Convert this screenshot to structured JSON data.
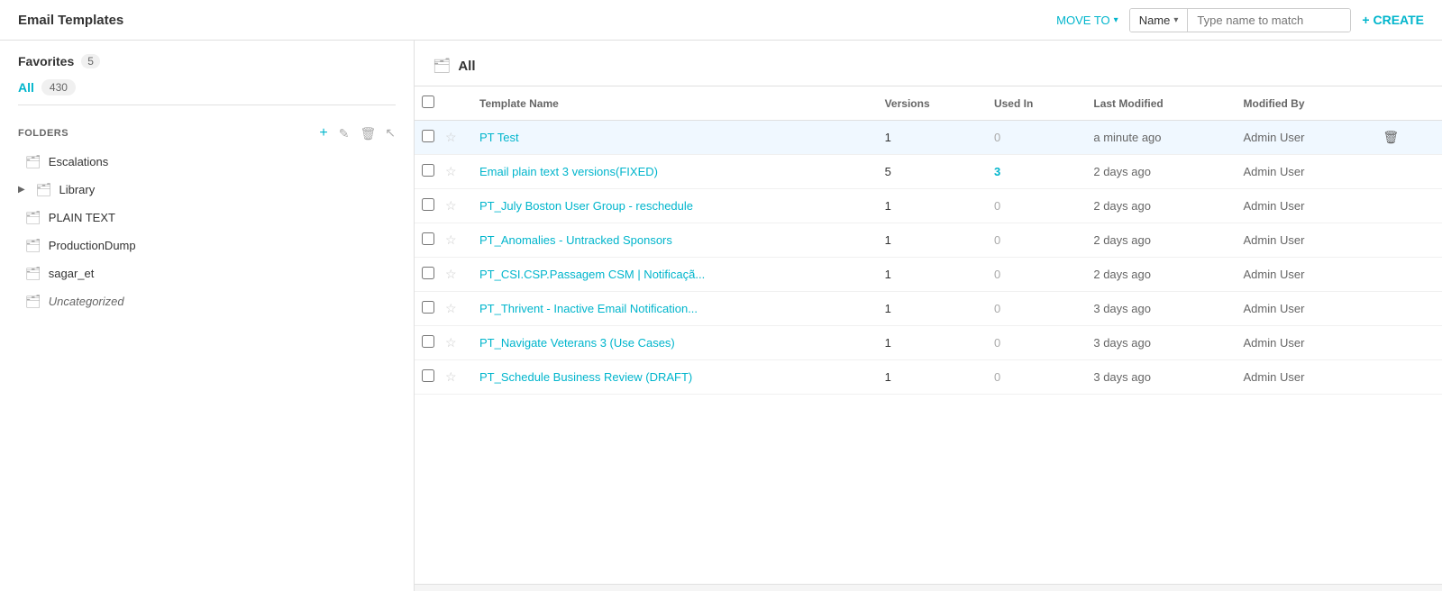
{
  "header": {
    "title": "Email Templates",
    "move_to_label": "MOVE TO",
    "filter_name_label": "Name",
    "filter_placeholder": "Type name to match",
    "create_label": "+ CREATE"
  },
  "sidebar": {
    "favorites_label": "Favorites",
    "favorites_count": "5",
    "all_label": "All",
    "all_count": "430",
    "folders_section_label": "FOLDERS",
    "folders": [
      {
        "name": "Escalations",
        "has_arrow": false,
        "italic": false
      },
      {
        "name": "Library",
        "has_arrow": true,
        "italic": false
      },
      {
        "name": "PLAIN TEXT",
        "has_arrow": false,
        "italic": false
      },
      {
        "name": "ProductionDump",
        "has_arrow": false,
        "italic": false
      },
      {
        "name": "sagar_et",
        "has_arrow": false,
        "italic": false
      },
      {
        "name": "Uncategorized",
        "has_arrow": false,
        "italic": true
      }
    ]
  },
  "content": {
    "heading": "All",
    "table": {
      "columns": [
        "Template Name",
        "Versions",
        "Used In",
        "Last Modified",
        "Modified By"
      ],
      "rows": [
        {
          "name": "PT Test",
          "versions": "1",
          "used_in": "0",
          "used_in_nonzero": false,
          "last_modified": "a minute ago",
          "modified_by": "Admin User",
          "highlight": true
        },
        {
          "name": "Email plain text 3 versions(FIXED)",
          "versions": "5",
          "used_in": "3",
          "used_in_nonzero": true,
          "last_modified": "2 days ago",
          "modified_by": "Admin User",
          "highlight": false
        },
        {
          "name": "PT_July Boston User Group - reschedule",
          "versions": "1",
          "used_in": "0",
          "used_in_nonzero": false,
          "last_modified": "2 days ago",
          "modified_by": "Admin User",
          "highlight": false
        },
        {
          "name": "PT_Anomalies - Untracked Sponsors",
          "versions": "1",
          "used_in": "0",
          "used_in_nonzero": false,
          "last_modified": "2 days ago",
          "modified_by": "Admin User",
          "highlight": false
        },
        {
          "name": "PT_CSI.CSP.Passagem CSM | Notificaçã...",
          "versions": "1",
          "used_in": "0",
          "used_in_nonzero": false,
          "last_modified": "2 days ago",
          "modified_by": "Admin User",
          "highlight": false
        },
        {
          "name": "PT_Thrivent - Inactive Email Notification...",
          "versions": "1",
          "used_in": "0",
          "used_in_nonzero": false,
          "last_modified": "3 days ago",
          "modified_by": "Admin User",
          "highlight": false
        },
        {
          "name": "PT_Navigate Veterans 3 (Use Cases)",
          "versions": "1",
          "used_in": "0",
          "used_in_nonzero": false,
          "last_modified": "3 days ago",
          "modified_by": "Admin User",
          "highlight": false
        },
        {
          "name": "PT_Schedule Business Review (DRAFT)",
          "versions": "1",
          "used_in": "0",
          "used_in_nonzero": false,
          "last_modified": "3 days ago",
          "modified_by": "Admin User",
          "highlight": false
        }
      ]
    }
  }
}
